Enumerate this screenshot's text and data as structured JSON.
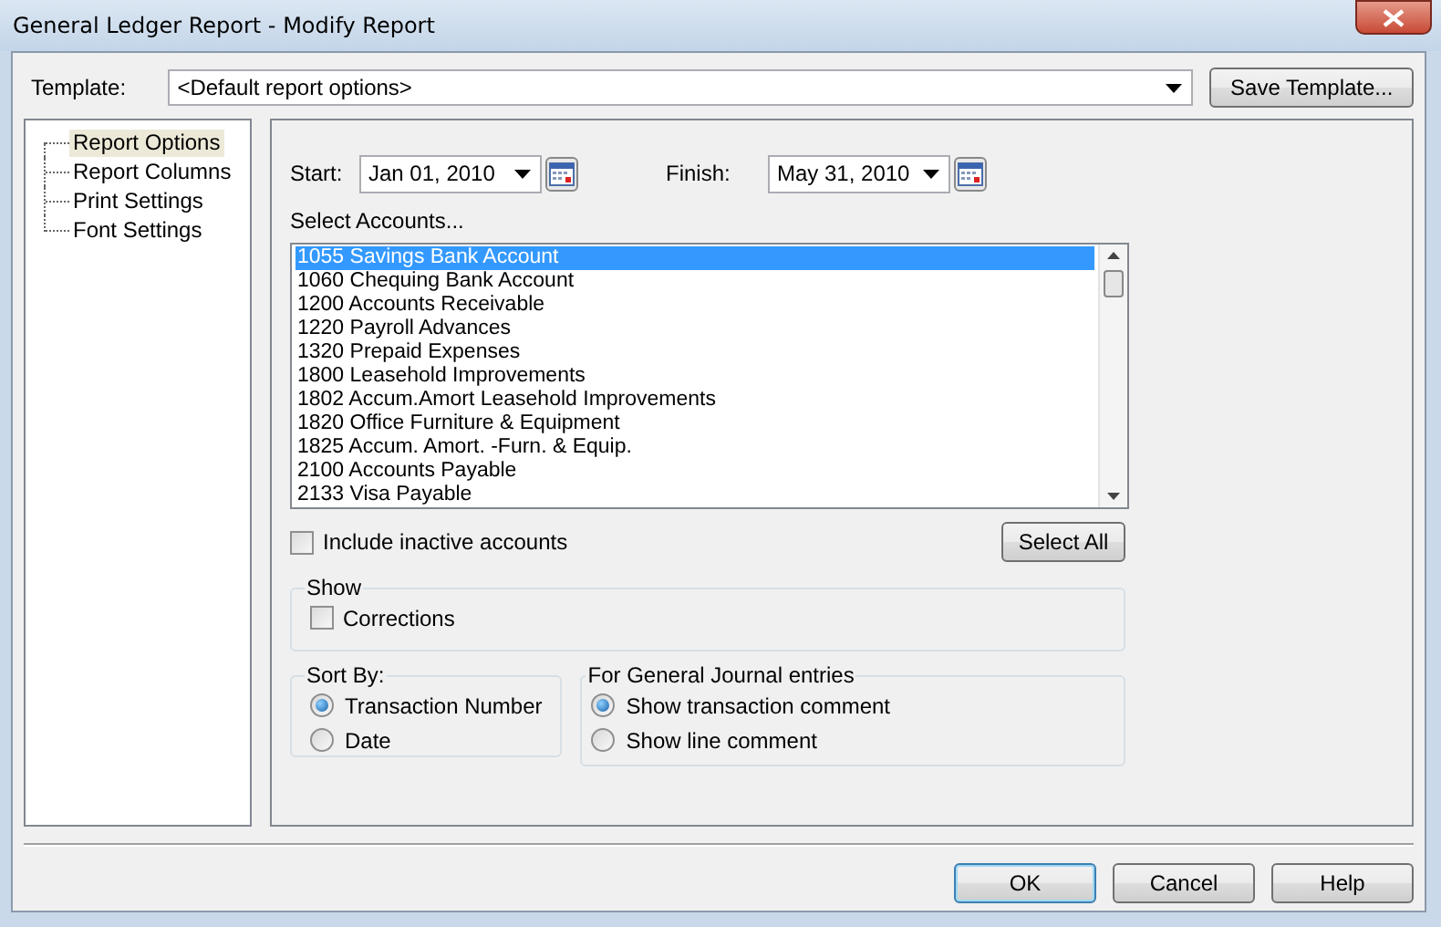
{
  "window": {
    "title": "General Ledger Report - Modify Report"
  },
  "template": {
    "label": "Template:",
    "value": "<Default report options>",
    "save_button": "Save Template..."
  },
  "tree": [
    {
      "label": "Report Options",
      "selected": true
    },
    {
      "label": "Report Columns",
      "selected": false
    },
    {
      "label": "Print Settings",
      "selected": false
    },
    {
      "label": "Font Settings",
      "selected": false
    }
  ],
  "start": {
    "label": "Start:",
    "value": "Jan 01, 2010"
  },
  "finish": {
    "label": "Finish:",
    "value": "May 31, 2010"
  },
  "accounts": {
    "label": "Select Accounts...",
    "items": [
      {
        "label": "1055 Savings Bank Account",
        "selected": true
      },
      {
        "label": "1060 Chequing Bank Account",
        "selected": false
      },
      {
        "label": "1200 Accounts Receivable",
        "selected": false
      },
      {
        "label": "1220 Payroll Advances",
        "selected": false
      },
      {
        "label": "1320 Prepaid Expenses",
        "selected": false
      },
      {
        "label": "1800 Leasehold Improvements",
        "selected": false
      },
      {
        "label": "1802 Accum.Amort Leasehold Improvements",
        "selected": false
      },
      {
        "label": "1820 Office Furniture & Equipment",
        "selected": false
      },
      {
        "label": "1825 Accum. Amort. -Furn. & Equip.",
        "selected": false
      },
      {
        "label": "2100 Accounts Payable",
        "selected": false
      },
      {
        "label": "2133 Visa Payable",
        "selected": false
      }
    ]
  },
  "include_inactive": {
    "label": "Include inactive accounts",
    "checked": false
  },
  "select_all_button": "Select All",
  "show": {
    "title": "Show",
    "options": [
      {
        "label": "Corrections",
        "checked": false
      }
    ]
  },
  "sort_by": {
    "title": "Sort By:",
    "options": [
      {
        "label": "Transaction Number",
        "selected": true
      },
      {
        "label": "Date",
        "selected": false
      }
    ]
  },
  "journal": {
    "title": "For General Journal entries",
    "options": [
      {
        "label": "Show transaction comment",
        "selected": true
      },
      {
        "label": "Show line comment",
        "selected": false
      }
    ]
  },
  "buttons": [
    {
      "label": "OK",
      "default": true
    },
    {
      "label": "Cancel",
      "default": false
    },
    {
      "label": "Help",
      "default": false
    }
  ]
}
